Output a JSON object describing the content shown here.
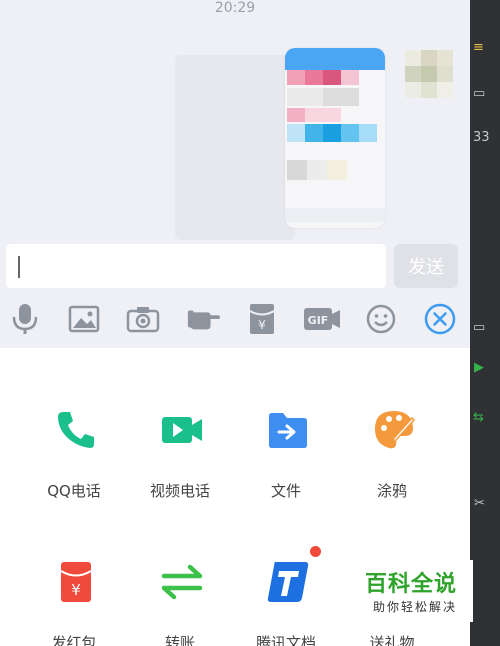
{
  "status_bar": {
    "time": "20:29"
  },
  "composer": {
    "input_value": "",
    "send_label": "发送"
  },
  "toolbar": {
    "icons": [
      "microphone-icon",
      "image-icon",
      "camera-icon",
      "poke-hand-icon",
      "red-packet-icon",
      "gif-icon",
      "emoji-icon",
      "close-circle-icon"
    ]
  },
  "panel": {
    "items": [
      {
        "label": "QQ电话",
        "icon": "phone-icon"
      },
      {
        "label": "视频电话",
        "icon": "video-call-icon"
      },
      {
        "label": "文件",
        "icon": "folder-icon"
      },
      {
        "label": "涂鸦",
        "icon": "palette-icon"
      },
      {
        "label": "发红包",
        "icon": "red-envelope-icon"
      },
      {
        "label": "转账",
        "icon": "transfer-icon"
      },
      {
        "label": "腾讯文档",
        "icon": "tencent-docs-icon"
      },
      {
        "label": "送礼物",
        "icon": "gift-icon"
      }
    ]
  },
  "watermark": {
    "title": "百科全说",
    "subtitle": "助你轻松解决"
  },
  "colors": {
    "chat_background": "#eef0f5",
    "accent_blue": "#3d9bf0",
    "phone_green": "#1bbf8c",
    "palette_orange": "#f59a3c",
    "red_packet": "#f04a3c",
    "transfer_green": "#3cc14a",
    "watermark_green": "#2fa32b"
  }
}
